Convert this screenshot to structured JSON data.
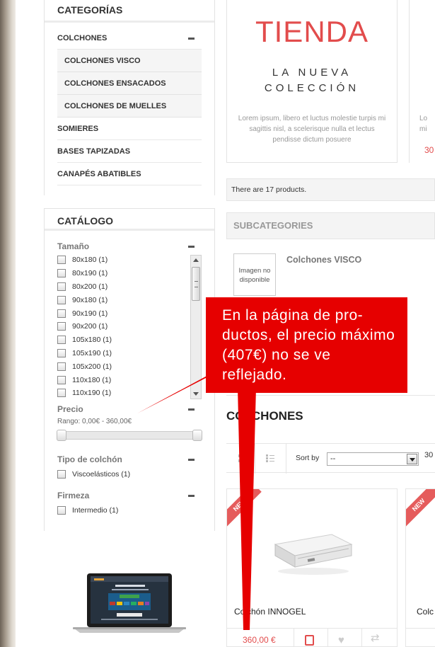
{
  "sidebar": {
    "categories_title": "CATEGORÍAS",
    "categories": [
      {
        "label": "COLCHONES"
      },
      {
        "label": "SOMIERES"
      },
      {
        "label": "BASES TAPIZADAS"
      },
      {
        "label": "CANAPÉS ABATIBLES"
      }
    ],
    "subcategories": [
      "COLCHONES VISCO",
      "COLCHONES ENSACADOS",
      "COLCHONES DE MUELLES"
    ],
    "catalog_title": "CATÁLOGO",
    "size_title": "Tamaño",
    "sizes": [
      "80x180 (1)",
      "80x190 (1)",
      "80x200 (1)",
      "90x180 (1)",
      "90x190 (1)",
      "90x200 (1)",
      "105x180 (1)",
      "105x190 (1)",
      "105x200 (1)",
      "110x180 (1)",
      "110x190 (1)"
    ],
    "price_title": "Precio",
    "price_range": "Rango: 0,00€ - 360,00€",
    "mattress_type_title": "Tipo de colchón",
    "mattress_types": [
      "Viscoelásticos (1)"
    ],
    "firmness_title": "Firmeza",
    "firmness": [
      "Intermedio (1)"
    ]
  },
  "banner": {
    "title": "TIENDA",
    "line1": "LA NUEVA",
    "line2": "COLECCIÓN",
    "lorem": "Lorem ipsum, libero et luctus molestie turpis mi sagittis nisl, a scelerisque nulla et lectus pendisse dictum posuere",
    "edge_text": "Lo mi"
  },
  "product_count": "There are 17 products.",
  "subcategories_heading": "SUBCATEGORIES",
  "subcategory": {
    "no_image": "Imagen no disponible",
    "name": "Colchones VISCO"
  },
  "callout": "En la página de pro-ductos, el precio máximo (407€) no se ve reflejado.",
  "category_heading": "COLCHONES",
  "sort": {
    "label": "Sort by",
    "selected": "--",
    "extra": "30"
  },
  "products": [
    {
      "badge": "NEW",
      "name": "Colchón INNOGEL",
      "price": "360,00 €"
    },
    {
      "badge": "NEW",
      "name": "Colc",
      "price": "30"
    }
  ],
  "colors": {
    "accent": "#e24c4c",
    "callout": "#e60000"
  }
}
